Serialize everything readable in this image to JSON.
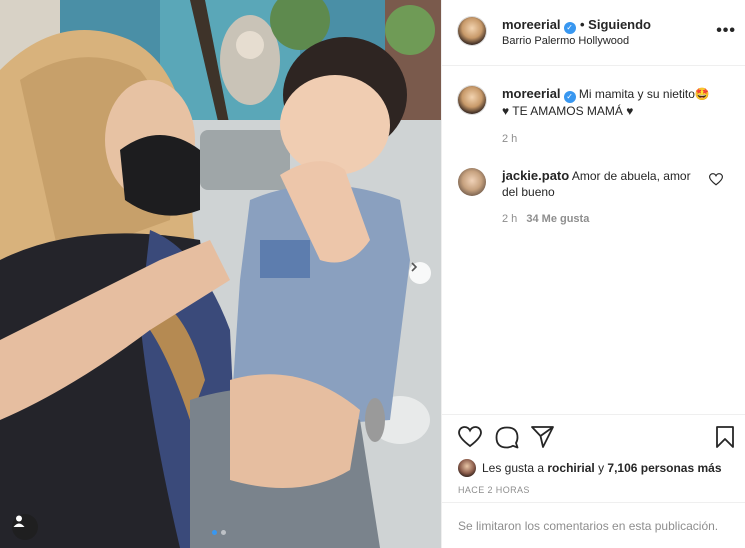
{
  "post": {
    "author": "moreerial",
    "follow_status": "• Siguiendo",
    "location": "Barrio Palermo Hollywood",
    "more_icon": "•••"
  },
  "caption": {
    "username": "moreerial",
    "text_line1": "Mi mamita y su nietito🤩",
    "text_line2": "♥ TE AMAMOS MAMÁ ♥",
    "age": "2 h"
  },
  "comments": [
    {
      "username": "jackie.pato",
      "text_line1": "Amor de abuela, amor",
      "text_line2": "del bueno",
      "age": "2 h",
      "likes": "34 Me gusta"
    }
  ],
  "likes": {
    "prefix": "Les gusta a ",
    "user": "rochirial",
    "connector": " y ",
    "count": "7,106 personas más"
  },
  "timestamp": "HACE 2 HORAS",
  "comments_disabled": "Se limitaron los comentarios en esta publicación.",
  "carousel": {
    "current": 1,
    "total": 2
  },
  "colors": {
    "verified": "#3897f0",
    "muted": "#8e8e8e",
    "text": "#262626"
  }
}
